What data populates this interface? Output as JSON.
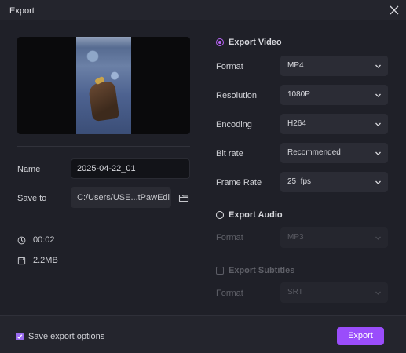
{
  "window": {
    "title": "Export",
    "close_icon": "close-icon"
  },
  "left": {
    "name_label": "Name",
    "name_value": "2025-04-22_01",
    "save_to_label": "Save to",
    "save_to_value": "C:/Users/USE...tPawEdimakor",
    "folder_icon": "folder-icon",
    "duration": "00:02",
    "size": "2.2MB"
  },
  "video": {
    "section_title": "Export Video",
    "selected": true,
    "format_label": "Format",
    "format_value": "MP4",
    "resolution_label": "Resolution",
    "resolution_value": "1080P",
    "encoding_label": "Encoding",
    "encoding_value": "H264",
    "bitrate_label": "Bit rate",
    "bitrate_value": "Recommended",
    "framerate_label": "Frame Rate",
    "framerate_value": "25  fps"
  },
  "audio": {
    "section_title": "Export Audio",
    "selected": false,
    "format_label": "Format",
    "format_value": "MP3"
  },
  "subtitles": {
    "section_title": "Export Subtitles",
    "checked": false,
    "format_label": "Format",
    "format_value": "SRT"
  },
  "footer": {
    "save_options_label": "Save export options",
    "save_options_checked": true,
    "export_button": "Export"
  },
  "colors": {
    "accent": "#9a4dfb",
    "background": "#1f2028",
    "field": "#2b2c35"
  }
}
